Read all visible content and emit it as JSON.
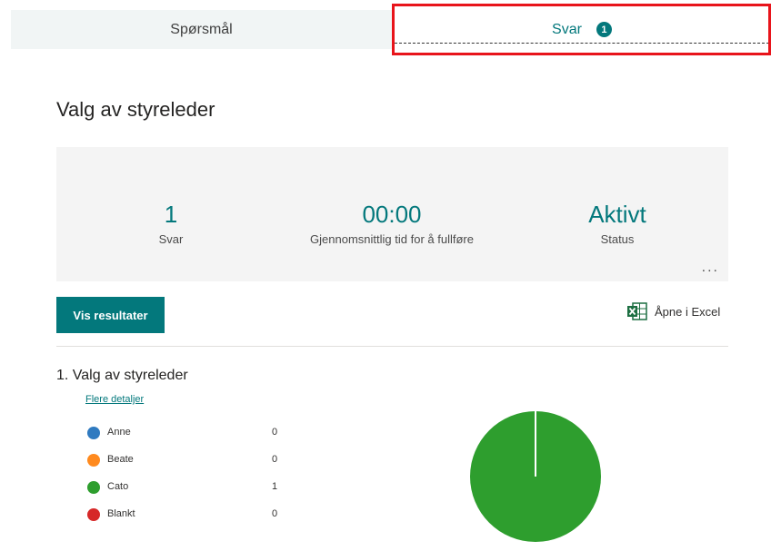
{
  "tabs": {
    "questions_label": "Spørsmål",
    "responses_label": "Svar",
    "responses_badge": "1"
  },
  "form_title": "Valg av styreleder",
  "stats": {
    "responses_value": "1",
    "responses_label": "Svar",
    "avg_time_value": "00:00",
    "avg_time_label": "Gjennomsnittlig tid for å fullføre",
    "status_value": "Aktivt",
    "status_label": "Status",
    "more_label": "..."
  },
  "actions": {
    "view_results_label": "Vis resultater",
    "open_excel_label": "Åpne i Excel",
    "excel_icon": "excel-icon"
  },
  "question": {
    "title": "1.  Valg av styreleder",
    "details_link": "Flere detaljer"
  },
  "chart_data": {
    "type": "pie",
    "title": "",
    "series": [
      {
        "name": "Anne",
        "value": 0,
        "color": "#2f7ac0"
      },
      {
        "name": "Beate",
        "value": 0,
        "color": "#ff8a1e"
      },
      {
        "name": "Cato",
        "value": 1,
        "color": "#2e9e2e"
      },
      {
        "name": "Blankt",
        "value": 0,
        "color": "#d62828"
      }
    ]
  },
  "colors": {
    "accent": "#03787c",
    "highlight": "#e8141b"
  }
}
